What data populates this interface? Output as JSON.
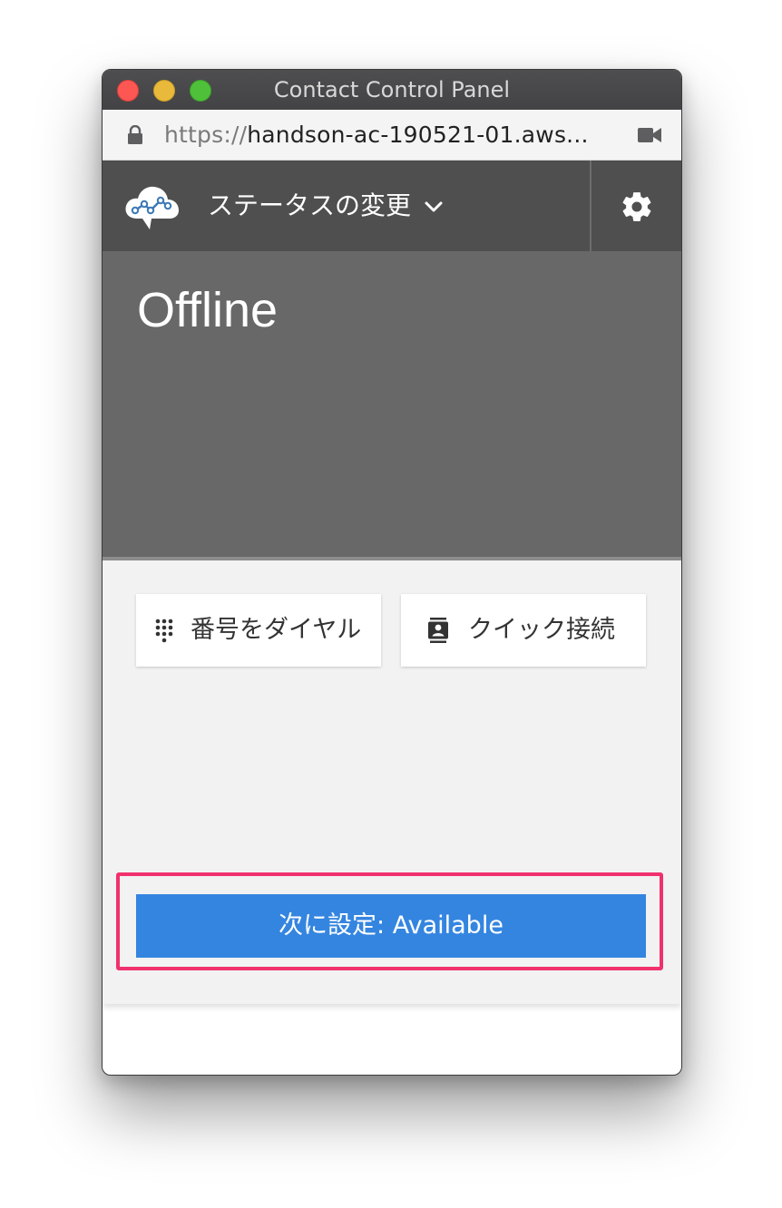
{
  "window": {
    "title": "Contact Control Panel"
  },
  "urlbar": {
    "scheme": "https://",
    "host": "handson-ac-190521-01.aws..."
  },
  "header": {
    "status_menu_label": "ステータスの変更",
    "logo_icon": "amazon-connect-logo-icon",
    "settings_icon": "gear-icon"
  },
  "status": {
    "label": "Offline"
  },
  "actions": {
    "dial_label": "番号をダイヤル",
    "dial_icon": "dialpad-icon",
    "quick_connect_label": "クイック接続",
    "quick_connect_icon": "contact-book-icon"
  },
  "next_status": {
    "label": "次に設定: Available"
  },
  "colors": {
    "header_bg": "#4f4f4f",
    "status_bg": "#686868",
    "primary_button": "#3485e0",
    "highlight_border": "#f0316d"
  }
}
